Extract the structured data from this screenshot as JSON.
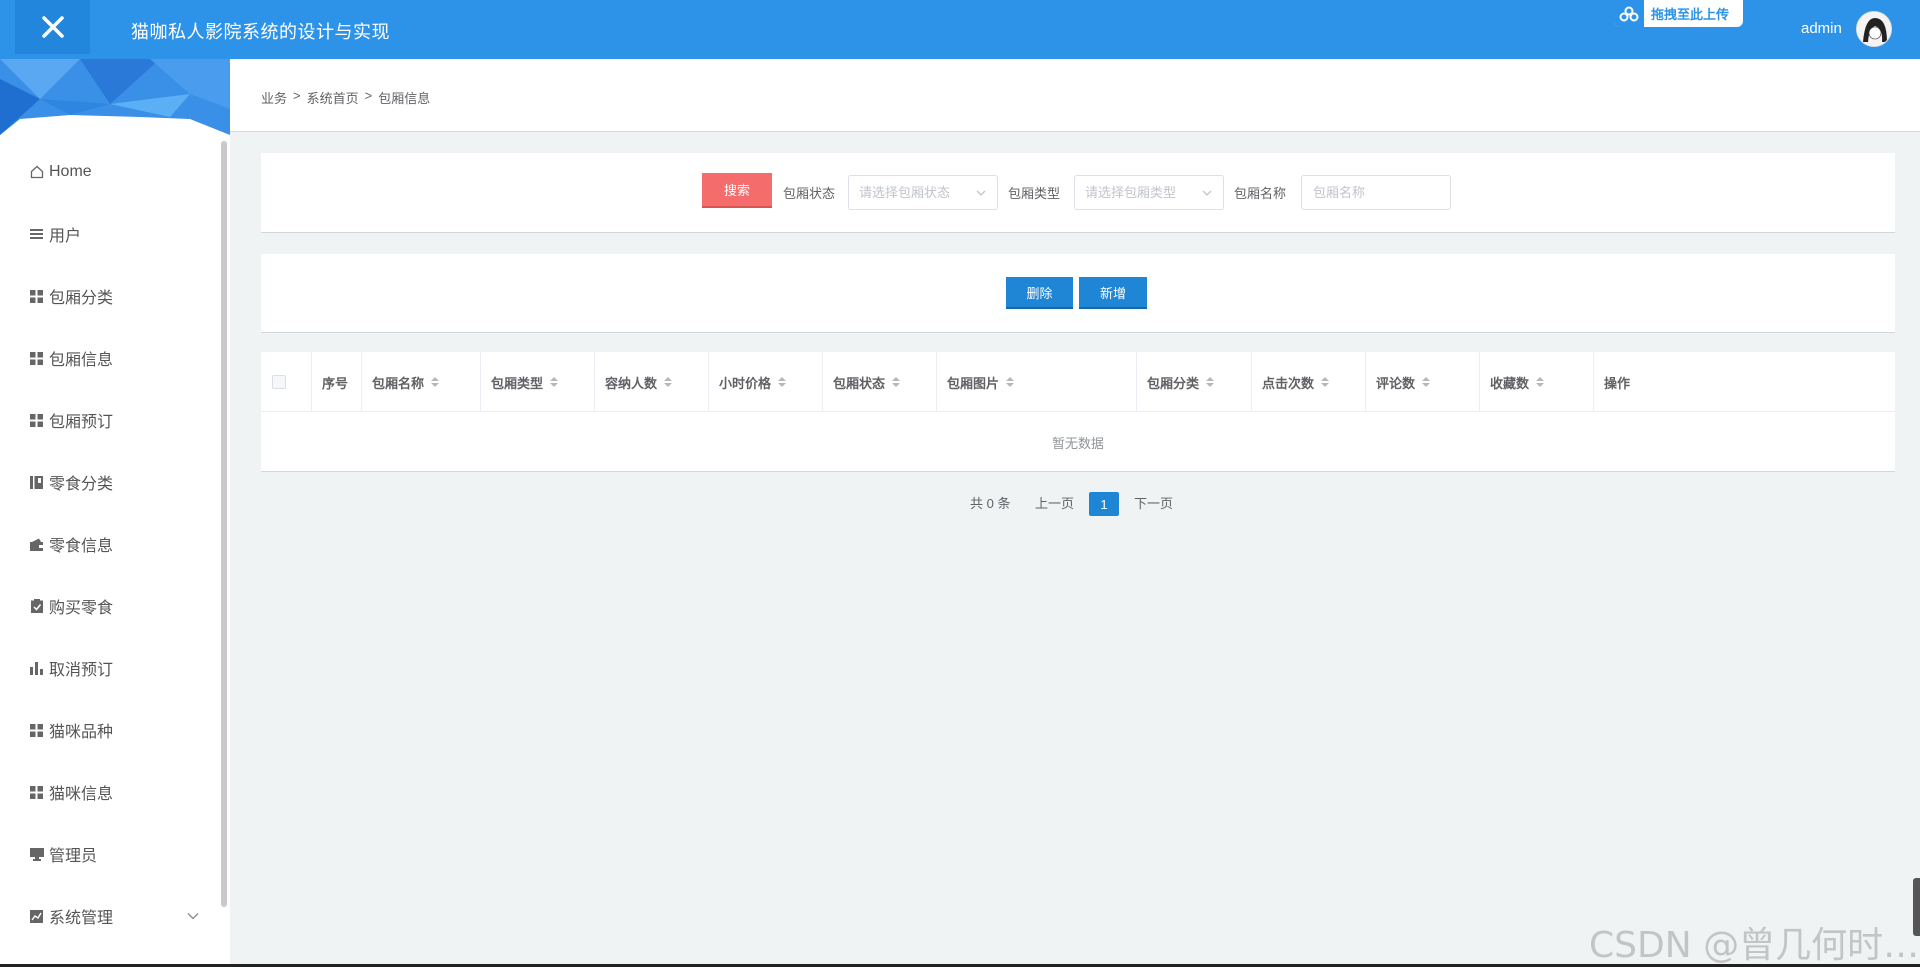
{
  "header": {
    "title": "猫咖私人影院系统的设计与实现",
    "upload_label": "拖拽至此上传",
    "username": "admin"
  },
  "sidebar": {
    "items": [
      {
        "label": "Home",
        "icon": "home-icon"
      },
      {
        "label": "用户",
        "icon": "list-icon"
      },
      {
        "label": "包厢分类",
        "icon": "grid-icon"
      },
      {
        "label": "包厢信息",
        "icon": "grid-icon"
      },
      {
        "label": "包厢预订",
        "icon": "grid-icon"
      },
      {
        "label": "零食分类",
        "icon": "book-icon"
      },
      {
        "label": "零食信息",
        "icon": "wallet-icon"
      },
      {
        "label": "购买零食",
        "icon": "clipboard-icon"
      },
      {
        "label": "取消预订",
        "icon": "bar-chart-icon"
      },
      {
        "label": "猫咪品种",
        "icon": "grid-icon"
      },
      {
        "label": "猫咪信息",
        "icon": "grid-icon"
      },
      {
        "label": "管理员",
        "icon": "monitor-icon"
      },
      {
        "label": "系统管理",
        "icon": "chart-icon"
      }
    ]
  },
  "breadcrumb": [
    "业务",
    ">",
    "系统首页",
    ">",
    "包厢信息"
  ],
  "search": {
    "button": "搜索",
    "status_label": "包厢状态",
    "status_placeholder": "请选择包厢状态",
    "type_label": "包厢类型",
    "type_placeholder": "请选择包厢类型",
    "name_label": "包厢名称",
    "name_placeholder": "包厢名称"
  },
  "actions": {
    "delete": "删除",
    "add": "新增"
  },
  "table": {
    "columns": [
      "序号",
      "包厢名称",
      "包厢类型",
      "容纳人数",
      "小时价格",
      "包厢状态",
      "包厢图片",
      "包厢分类",
      "点击次数",
      "评论数",
      "收藏数",
      "操作"
    ],
    "empty_text": "暂无数据"
  },
  "pagination": {
    "total": "共 0 条",
    "prev": "上一页",
    "current": "1",
    "next": "下一页"
  },
  "watermark": "CSDN @曾几何时…",
  "colors": {
    "header": "#2c93e9",
    "search_button": "#f56c6c",
    "primary_button": "#1f86d6"
  }
}
